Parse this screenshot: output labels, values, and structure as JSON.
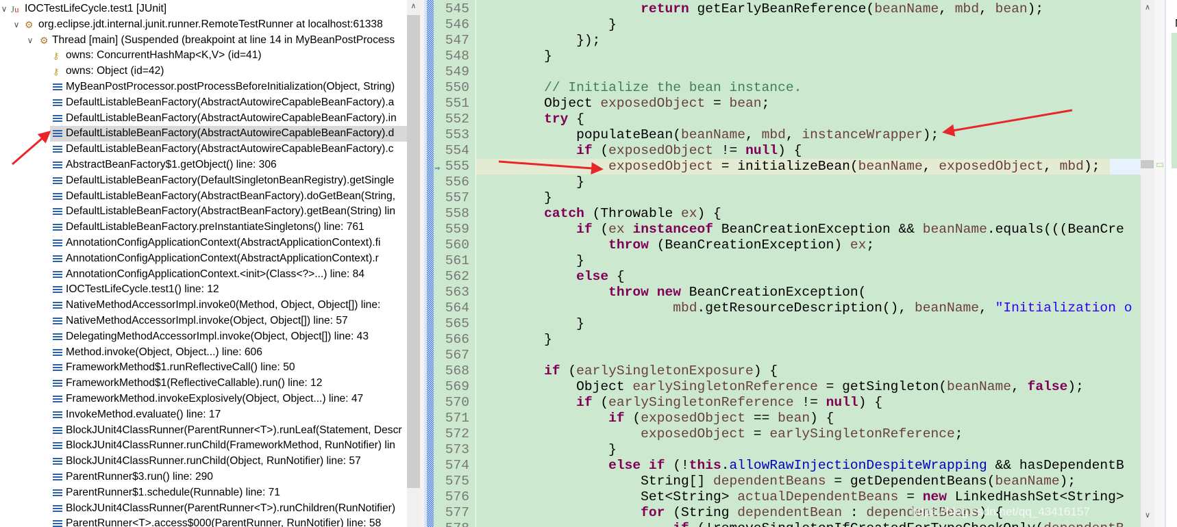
{
  "debug_view": {
    "items": [
      {
        "label": "IOCTestLifeCycle.test1 [JUnit]",
        "icon": "junit-icon",
        "level": 0,
        "expanded": true
      },
      {
        "label": "org.eclipse.jdt.internal.junit.runner.RemoteTestRunner at localhost:61338",
        "icon": "launch-gear-icon",
        "level": 1,
        "expanded": true
      },
      {
        "label": "Thread [main] (Suspended (breakpoint at line 14 in MyBeanPostProcess",
        "icon": "thread-suspended-icon",
        "level": 2,
        "expanded": true
      },
      {
        "label": "owns: ConcurrentHashMap<K,V>  (id=41)",
        "icon": "monitor-key-icon",
        "level": 3
      },
      {
        "label": "owns: Object  (id=42)",
        "icon": "monitor-key-icon",
        "level": 3
      },
      {
        "label": "MyBeanPostProcessor.postProcessBeforeInitialization(Object, String)",
        "icon": "stack-frame-icon",
        "level": 3
      },
      {
        "label": "DefaultListableBeanFactory(AbstractAutowireCapableBeanFactory).a",
        "icon": "stack-frame-icon",
        "level": 3
      },
      {
        "label": "DefaultListableBeanFactory(AbstractAutowireCapableBeanFactory).in",
        "icon": "stack-frame-icon",
        "level": 3
      },
      {
        "label": "DefaultListableBeanFactory(AbstractAutowireCapableBeanFactory).d",
        "icon": "stack-frame-icon",
        "level": 3,
        "selected": true
      },
      {
        "label": "DefaultListableBeanFactory(AbstractAutowireCapableBeanFactory).c",
        "icon": "stack-frame-icon",
        "level": 3
      },
      {
        "label": "AbstractBeanFactory$1.getObject() line: 306",
        "icon": "stack-frame-icon",
        "level": 3
      },
      {
        "label": "DefaultListableBeanFactory(DefaultSingletonBeanRegistry).getSingle",
        "icon": "stack-frame-icon",
        "level": 3
      },
      {
        "label": "DefaultListableBeanFactory(AbstractBeanFactory).doGetBean(String,",
        "icon": "stack-frame-icon",
        "level": 3
      },
      {
        "label": "DefaultListableBeanFactory(AbstractBeanFactory).getBean(String) lin",
        "icon": "stack-frame-icon",
        "level": 3
      },
      {
        "label": "DefaultListableBeanFactory.preInstantiateSingletons() line: 761",
        "icon": "stack-frame-icon",
        "level": 3
      },
      {
        "label": "AnnotationConfigApplicationContext(AbstractApplicationContext).fi",
        "icon": "stack-frame-icon",
        "level": 3
      },
      {
        "label": "AnnotationConfigApplicationContext(AbstractApplicationContext).r",
        "icon": "stack-frame-icon",
        "level": 3
      },
      {
        "label": "AnnotationConfigApplicationContext.<init>(Class<?>...) line: 84",
        "icon": "stack-frame-icon",
        "level": 3
      },
      {
        "label": "IOCTestLifeCycle.test1() line: 12",
        "icon": "stack-frame-icon",
        "level": 3
      },
      {
        "label": "NativeMethodAccessorImpl.invoke0(Method, Object, Object[]) line:",
        "icon": "stack-frame-icon",
        "level": 3
      },
      {
        "label": "NativeMethodAccessorImpl.invoke(Object, Object[]) line: 57",
        "icon": "stack-frame-icon",
        "level": 3
      },
      {
        "label": "DelegatingMethodAccessorImpl.invoke(Object, Object[]) line: 43",
        "icon": "stack-frame-icon",
        "level": 3
      },
      {
        "label": "Method.invoke(Object, Object...) line: 606",
        "icon": "stack-frame-icon",
        "level": 3
      },
      {
        "label": "FrameworkMethod$1.runReflectiveCall() line: 50",
        "icon": "stack-frame-icon",
        "level": 3
      },
      {
        "label": "FrameworkMethod$1(ReflectiveCallable).run() line: 12",
        "icon": "stack-frame-icon",
        "level": 3
      },
      {
        "label": "FrameworkMethod.invokeExplosively(Object, Object...) line: 47",
        "icon": "stack-frame-icon",
        "level": 3
      },
      {
        "label": "InvokeMethod.evaluate() line: 17",
        "icon": "stack-frame-icon",
        "level": 3
      },
      {
        "label": "BlockJUnit4ClassRunner(ParentRunner<T>).runLeaf(Statement, Descr",
        "icon": "stack-frame-icon",
        "level": 3
      },
      {
        "label": "BlockJUnit4ClassRunner.runChild(FrameworkMethod, RunNotifier) lin",
        "icon": "stack-frame-icon",
        "level": 3
      },
      {
        "label": "BlockJUnit4ClassRunner.runChild(Object, RunNotifier) line: 57",
        "icon": "stack-frame-icon",
        "level": 3
      },
      {
        "label": "ParentRunner$3.run() line: 290",
        "icon": "stack-frame-icon",
        "level": 3
      },
      {
        "label": "ParentRunner$1.schedule(Runnable) line: 71",
        "icon": "stack-frame-icon",
        "level": 3
      },
      {
        "label": "BlockJUnit4ClassRunner(ParentRunner<T>).runChildren(RunNotifier)",
        "icon": "stack-frame-icon",
        "level": 3
      },
      {
        "label": "ParentRunner<T>.access$000(ParentRunner, RunNotifier) line: 58",
        "icon": "stack-frame-icon",
        "level": 3
      }
    ]
  },
  "editor": {
    "current_line": "555",
    "colors": {
      "background": "#cce8cf",
      "keyword": "#7f0055",
      "local_variable": "#6a3e3e",
      "comment": "#3f7f5f",
      "string": "#2a00ff",
      "field": "#0000c0"
    },
    "lines": [
      {
        "num": "545",
        "tokens": [
          {
            "t": "                    "
          },
          {
            "t": "return",
            "c": "kw"
          },
          {
            "t": " getEarlyBeanReference("
          },
          {
            "t": "beanName",
            "c": "var"
          },
          {
            "t": ", "
          },
          {
            "t": "mbd",
            "c": "var"
          },
          {
            "t": ", "
          },
          {
            "t": "bean",
            "c": "var"
          },
          {
            "t": ");"
          }
        ]
      },
      {
        "num": "546",
        "tokens": [
          {
            "t": "                }"
          }
        ]
      },
      {
        "num": "547",
        "tokens": [
          {
            "t": "            });"
          }
        ]
      },
      {
        "num": "548",
        "tokens": [
          {
            "t": "        }"
          }
        ]
      },
      {
        "num": "549",
        "tokens": []
      },
      {
        "num": "550",
        "tokens": [
          {
            "t": "        "
          },
          {
            "t": "// Initialize the bean instance.",
            "c": "cm"
          }
        ]
      },
      {
        "num": "551",
        "tokens": [
          {
            "t": "        Object "
          },
          {
            "t": "exposedObject",
            "c": "var"
          },
          {
            "t": " = "
          },
          {
            "t": "bean",
            "c": "var"
          },
          {
            "t": ";"
          }
        ]
      },
      {
        "num": "552",
        "tokens": [
          {
            "t": "        "
          },
          {
            "t": "try",
            "c": "kw"
          },
          {
            "t": " {"
          }
        ]
      },
      {
        "num": "553",
        "tokens": [
          {
            "t": "            populateBean("
          },
          {
            "t": "beanName",
            "c": "var"
          },
          {
            "t": ", "
          },
          {
            "t": "mbd",
            "c": "var"
          },
          {
            "t": ", "
          },
          {
            "t": "instanceWrapper",
            "c": "var"
          },
          {
            "t": ");"
          }
        ]
      },
      {
        "num": "554",
        "tokens": [
          {
            "t": "            "
          },
          {
            "t": "if",
            "c": "kw"
          },
          {
            "t": " ("
          },
          {
            "t": "exposedObject",
            "c": "var"
          },
          {
            "t": " != "
          },
          {
            "t": "null",
            "c": "kw"
          },
          {
            "t": ") {"
          }
        ]
      },
      {
        "num": "555",
        "tokens": [
          {
            "t": "                "
          },
          {
            "t": "exposedObject",
            "c": "var"
          },
          {
            "t": " = initializeBean("
          },
          {
            "t": "beanName",
            "c": "var"
          },
          {
            "t": ", "
          },
          {
            "t": "exposedObject",
            "c": "var"
          },
          {
            "t": ", "
          },
          {
            "t": "mbd",
            "c": "var"
          },
          {
            "t": ");"
          }
        ]
      },
      {
        "num": "556",
        "tokens": [
          {
            "t": "            }"
          }
        ]
      },
      {
        "num": "557",
        "tokens": [
          {
            "t": "        }"
          }
        ]
      },
      {
        "num": "558",
        "tokens": [
          {
            "t": "        "
          },
          {
            "t": "catch",
            "c": "kw"
          },
          {
            "t": " (Throwable "
          },
          {
            "t": "ex",
            "c": "var"
          },
          {
            "t": ") {"
          }
        ]
      },
      {
        "num": "559",
        "tokens": [
          {
            "t": "            "
          },
          {
            "t": "if",
            "c": "kw"
          },
          {
            "t": " ("
          },
          {
            "t": "ex",
            "c": "var"
          },
          {
            "t": " "
          },
          {
            "t": "instanceof",
            "c": "kw"
          },
          {
            "t": " BeanCreationException && "
          },
          {
            "t": "beanName",
            "c": "var"
          },
          {
            "t": ".equals(((BeanCre"
          }
        ]
      },
      {
        "num": "560",
        "tokens": [
          {
            "t": "                "
          },
          {
            "t": "throw",
            "c": "kw"
          },
          {
            "t": " (BeanCreationException) "
          },
          {
            "t": "ex",
            "c": "var"
          },
          {
            "t": ";"
          }
        ]
      },
      {
        "num": "561",
        "tokens": [
          {
            "t": "            }"
          }
        ]
      },
      {
        "num": "562",
        "tokens": [
          {
            "t": "            "
          },
          {
            "t": "else",
            "c": "kw"
          },
          {
            "t": " {"
          }
        ]
      },
      {
        "num": "563",
        "tokens": [
          {
            "t": "                "
          },
          {
            "t": "throw",
            "c": "kw"
          },
          {
            "t": " "
          },
          {
            "t": "new",
            "c": "kw"
          },
          {
            "t": " BeanCreationException("
          }
        ]
      },
      {
        "num": "564",
        "tokens": [
          {
            "t": "                        "
          },
          {
            "t": "mbd",
            "c": "var"
          },
          {
            "t": ".getResourceDescription(), "
          },
          {
            "t": "beanName",
            "c": "var"
          },
          {
            "t": ", "
          },
          {
            "t": "\"Initialization o",
            "c": "str"
          }
        ]
      },
      {
        "num": "565",
        "tokens": [
          {
            "t": "            }"
          }
        ]
      },
      {
        "num": "566",
        "tokens": [
          {
            "t": "        }"
          }
        ]
      },
      {
        "num": "567",
        "tokens": []
      },
      {
        "num": "568",
        "tokens": [
          {
            "t": "        "
          },
          {
            "t": "if",
            "c": "kw"
          },
          {
            "t": " ("
          },
          {
            "t": "earlySingletonExposure",
            "c": "var"
          },
          {
            "t": ") {"
          }
        ]
      },
      {
        "num": "569",
        "tokens": [
          {
            "t": "            Object "
          },
          {
            "t": "earlySingletonReference",
            "c": "var"
          },
          {
            "t": " = getSingleton("
          },
          {
            "t": "beanName",
            "c": "var"
          },
          {
            "t": ", "
          },
          {
            "t": "false",
            "c": "kw"
          },
          {
            "t": ");"
          }
        ]
      },
      {
        "num": "570",
        "tokens": [
          {
            "t": "            "
          },
          {
            "t": "if",
            "c": "kw"
          },
          {
            "t": " ("
          },
          {
            "t": "earlySingletonReference",
            "c": "var"
          },
          {
            "t": " != "
          },
          {
            "t": "null",
            "c": "kw"
          },
          {
            "t": ") {"
          }
        ]
      },
      {
        "num": "571",
        "tokens": [
          {
            "t": "                "
          },
          {
            "t": "if",
            "c": "kw"
          },
          {
            "t": " ("
          },
          {
            "t": "exposedObject",
            "c": "var"
          },
          {
            "t": " == "
          },
          {
            "t": "bean",
            "c": "var"
          },
          {
            "t": ") {"
          }
        ]
      },
      {
        "num": "572",
        "tokens": [
          {
            "t": "                    "
          },
          {
            "t": "exposedObject",
            "c": "var"
          },
          {
            "t": " = "
          },
          {
            "t": "earlySingletonReference",
            "c": "var"
          },
          {
            "t": ";"
          }
        ]
      },
      {
        "num": "573",
        "tokens": [
          {
            "t": "                }"
          }
        ]
      },
      {
        "num": "574",
        "tokens": [
          {
            "t": "                "
          },
          {
            "t": "else if",
            "c": "kw"
          },
          {
            "t": " (!"
          },
          {
            "t": "this",
            "c": "kw"
          },
          {
            "t": "."
          },
          {
            "t": "allowRawInjectionDespiteWrapping",
            "c": "fld"
          },
          {
            "t": " && hasDependentB"
          }
        ]
      },
      {
        "num": "575",
        "tokens": [
          {
            "t": "                    String[] "
          },
          {
            "t": "dependentBeans",
            "c": "var"
          },
          {
            "t": " = getDependentBeans("
          },
          {
            "t": "beanName",
            "c": "var"
          },
          {
            "t": ");"
          }
        ]
      },
      {
        "num": "576",
        "tokens": [
          {
            "t": "                    Set<String> "
          },
          {
            "t": "actualDependentBeans",
            "c": "var"
          },
          {
            "t": " = "
          },
          {
            "t": "new",
            "c": "kw"
          },
          {
            "t": " LinkedHashSet<String>"
          }
        ]
      },
      {
        "num": "577",
        "tokens": [
          {
            "t": "                    "
          },
          {
            "t": "for",
            "c": "kw"
          },
          {
            "t": " (String "
          },
          {
            "t": "dependentBean",
            "c": "var"
          },
          {
            "t": " : "
          },
          {
            "t": "dependentBeans",
            "c": "var"
          },
          {
            "t": ") {"
          }
        ]
      },
      {
        "num": "578",
        "tokens": [
          {
            "t": "                        "
          },
          {
            "t": "if",
            "c": "kw"
          },
          {
            "t": " (!removeSingletonIfCreatedForTypeCheckOnly("
          },
          {
            "t": "dependentB",
            "c": "var"
          }
        ]
      }
    ]
  },
  "right_panel": {
    "header": "N"
  },
  "annotations": {
    "arrow_color": "#e8262a"
  },
  "watermark": "https://blog.csdn.net/qq_43416157"
}
